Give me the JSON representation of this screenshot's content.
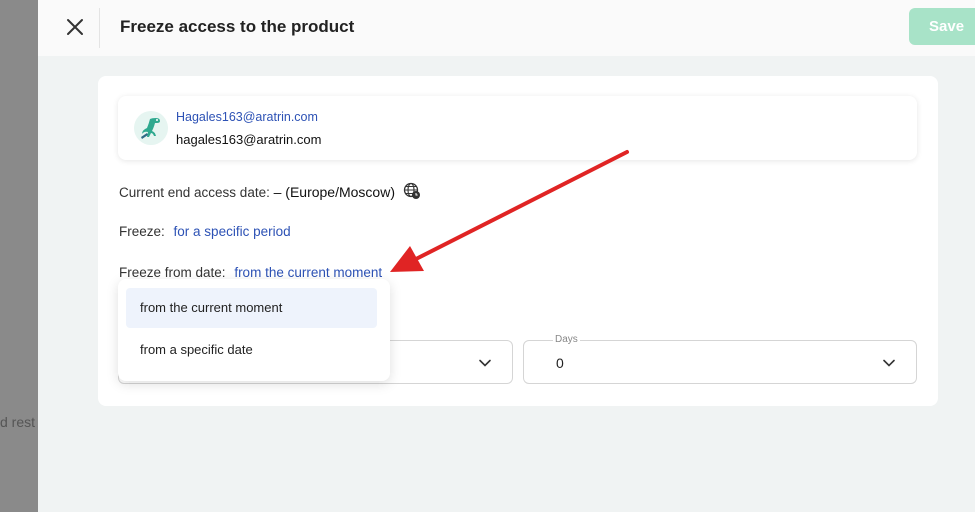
{
  "backdrop": {
    "text": "d rest"
  },
  "header": {
    "title": "Freeze access to the product",
    "save_label": "Save"
  },
  "user": {
    "email_link": "Hagales163@aratrin.com",
    "email": "hagales163@aratrin.com"
  },
  "access": {
    "label": "Current end access date:",
    "value": "– (Europe/Moscow)"
  },
  "freeze": {
    "label": "Freeze:",
    "value": "for a specific period"
  },
  "freeze_from": {
    "label": "Freeze from date:",
    "value": "from the current moment",
    "options": [
      "from the current moment",
      "from a specific date"
    ]
  },
  "period": {
    "days_label": "Days",
    "days_value": "0"
  },
  "colors": {
    "accent_link": "#2d52b5",
    "save_disabled": "#a8e3c8",
    "arrow": "#e02424",
    "option_highlight": "#eef3fc"
  }
}
